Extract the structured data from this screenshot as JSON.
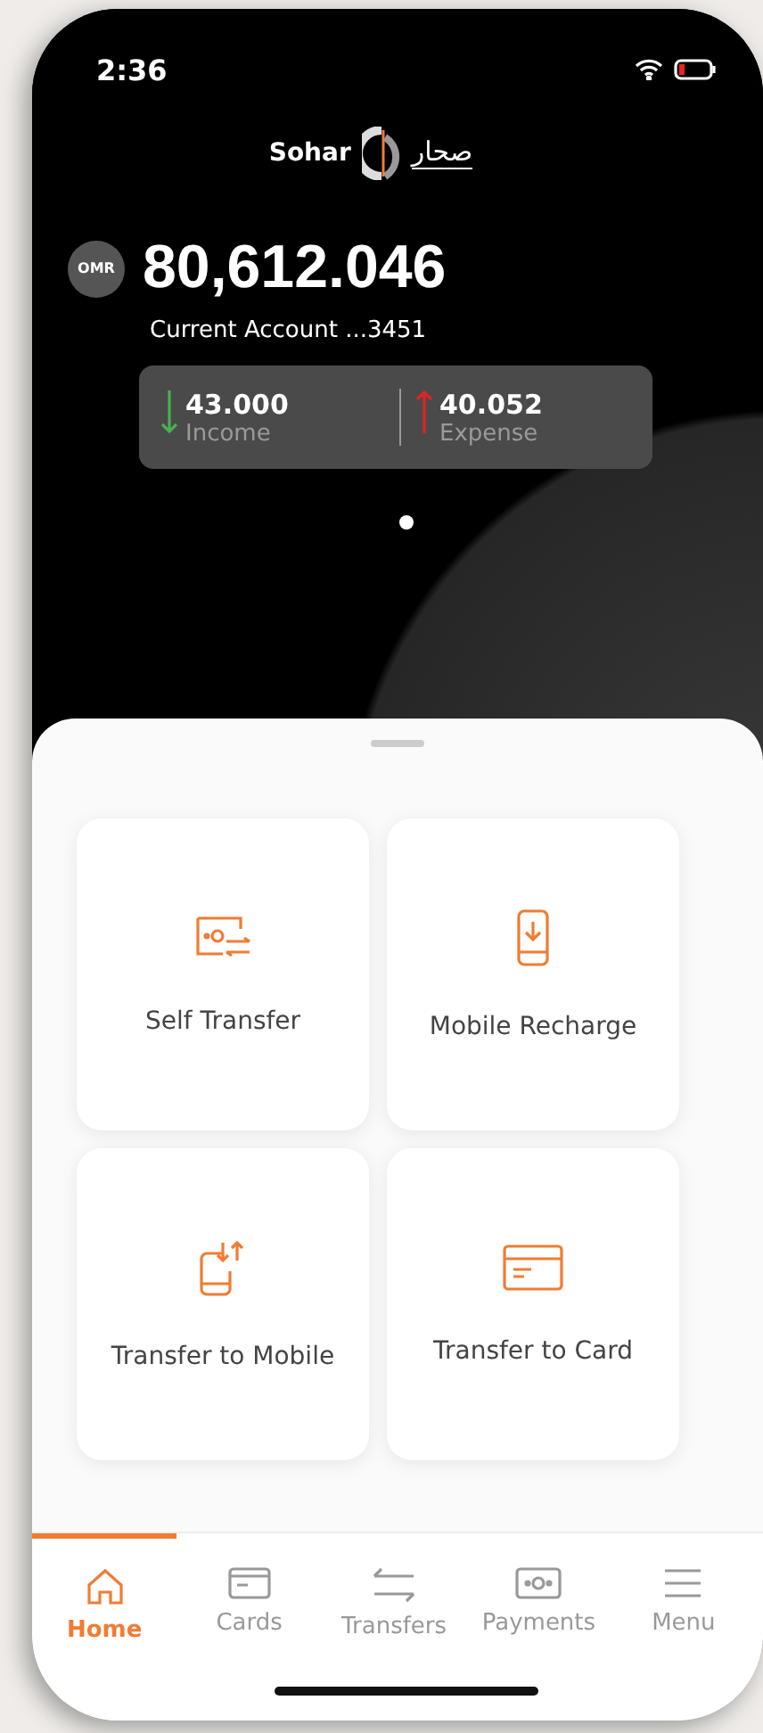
{
  "status_bar": {
    "time": "2:36"
  },
  "logo": {
    "latin": "Sohar",
    "arabic": "صحار"
  },
  "account": {
    "currency": "OMR",
    "balance": "80,612.046",
    "name": "Current Account ...3451"
  },
  "summary": [
    {
      "kind": "income",
      "amount": "43.000",
      "label": "Income"
    },
    {
      "kind": "expense",
      "amount": "40.052",
      "label": "Expense"
    }
  ],
  "actions": [
    {
      "kind": "self-transfer",
      "label": "Self Transfer"
    },
    {
      "kind": "mobile-recharge",
      "label": "Mobile Recharge"
    },
    {
      "kind": "transfer-mobile",
      "label": "Transfer to Mobile"
    },
    {
      "kind": "transfer-card",
      "label": "Transfer to Card"
    }
  ],
  "tabs": [
    {
      "kind": "home",
      "label": "Home",
      "selected": true
    },
    {
      "kind": "cards",
      "label": "Cards",
      "selected": false
    },
    {
      "kind": "transfers",
      "label": "Transfers",
      "selected": false
    },
    {
      "kind": "payments",
      "label": "Payments",
      "selected": false
    },
    {
      "kind": "menu",
      "label": "Menu",
      "selected": false
    }
  ]
}
